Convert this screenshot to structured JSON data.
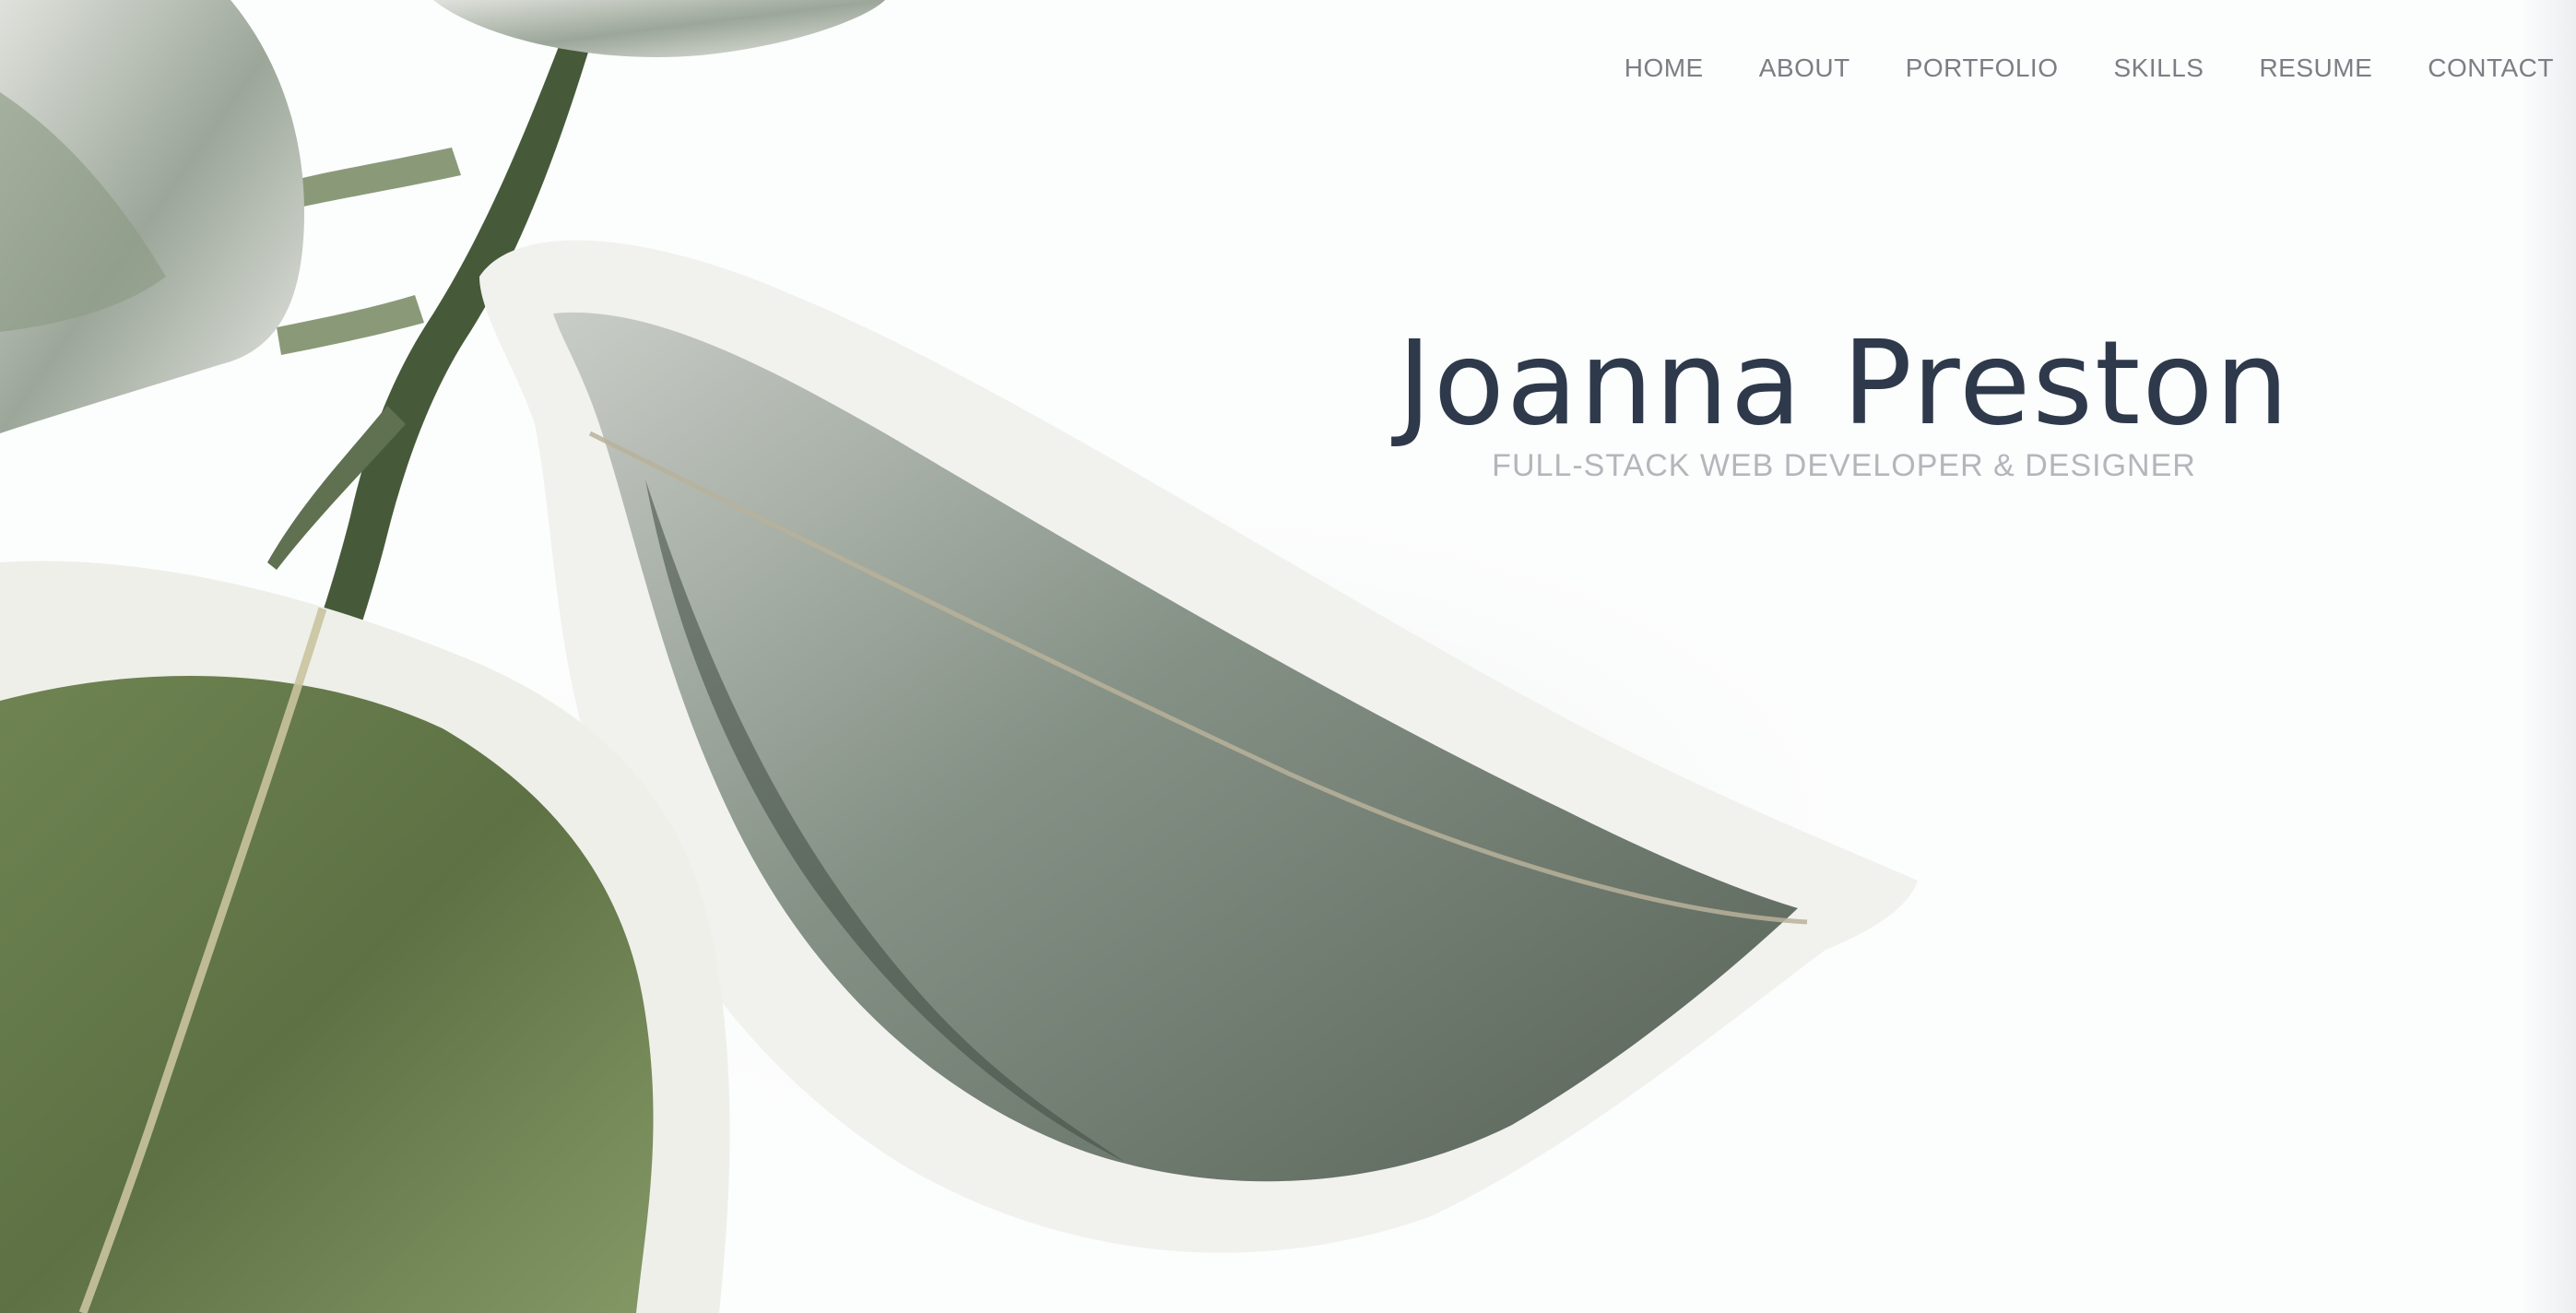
{
  "nav": {
    "items": [
      {
        "label": "HOME"
      },
      {
        "label": "ABOUT"
      },
      {
        "label": "PORTFOLIO"
      },
      {
        "label": "SKILLS"
      },
      {
        "label": "RESUME"
      },
      {
        "label": "CONTACT"
      }
    ]
  },
  "hero": {
    "name": "Joanna Preston",
    "subtitle": "FULL-STACK WEB DEVELOPER & DESIGNER"
  },
  "colors": {
    "heading": "#2e3a4b",
    "nav_text": "#7b7f84",
    "subtitle": "#b3b7bb",
    "background": "#fcfdfd"
  }
}
